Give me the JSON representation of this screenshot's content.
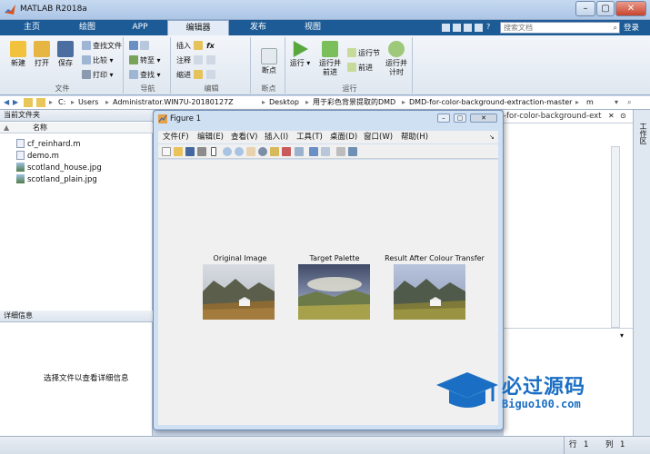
{
  "app": {
    "title": "MATLAB R2018a"
  },
  "tabs": [
    {
      "label": "主页"
    },
    {
      "label": "绘图"
    },
    {
      "label": "APP"
    },
    {
      "label": "编辑器"
    },
    {
      "label": "发布"
    },
    {
      "label": "视图"
    }
  ],
  "search": {
    "placeholder": "搜索文档",
    "login": "登录"
  },
  "ribbon": {
    "file": {
      "section": "文件",
      "new": "新建",
      "open": "打开",
      "save": "保存",
      "find_files": "查找文件",
      "compare": "比较",
      "print": "打印"
    },
    "nav": {
      "section": "导航",
      "goto": "转至",
      "find": "查找"
    },
    "edit": {
      "section": "编辑",
      "insert": "插入",
      "comment": "注释",
      "indent": "缩进",
      "fx": "fx"
    },
    "breakpoint": {
      "section": "断点",
      "label": "断点"
    },
    "run": {
      "section": "运行",
      "run": "运行",
      "run_advance": "运行并\n前进",
      "run_section": "运行节",
      "advance": "前进",
      "run_time": "运行并\n计时"
    }
  },
  "path": {
    "segments": [
      "C:",
      "Users",
      "Administrator.WIN7U-20180127Z",
      "Desktop",
      "用于彩色背景提取的DMD",
      "DMD-for-color-background-extraction-master",
      "m"
    ]
  },
  "current_folder": {
    "title": "当前文件夹",
    "col_name": "名称",
    "sort_arrow": "▲",
    "files": [
      {
        "name": "cf_reinhard.m",
        "type": "m"
      },
      {
        "name": "demo.m",
        "type": "m"
      },
      {
        "name": "scotland_house.jpg",
        "type": "img"
      },
      {
        "name": "scotland_plain.jpg",
        "type": "img"
      }
    ]
  },
  "details": {
    "title": "详细信息",
    "message": "选择文件以查看详细信息"
  },
  "figure": {
    "title": "Figure 1",
    "menu": [
      "文件(F)",
      "编辑(E)",
      "查看(V)",
      "插入(I)",
      "工具(T)",
      "桌面(D)",
      "窗口(W)",
      "帮助(H)"
    ],
    "plots": [
      {
        "label": "Original Image"
      },
      {
        "label": "Target Palette"
      },
      {
        "label": "Result After Colour Transfer"
      }
    ]
  },
  "behind_window": {
    "path_fragment": "-for-color-background-ext"
  },
  "side_strip": {
    "label": "工作区"
  },
  "status": {
    "row_label": "行",
    "row": "1",
    "col_label": "列",
    "col": "1"
  },
  "watermark": {
    "name": "必过源码",
    "url": "Biguo100.com"
  },
  "colors": {
    "accent": "#1c5b96",
    "ribbon": "#dfe7f0",
    "watermark": "#1a6fc4"
  }
}
